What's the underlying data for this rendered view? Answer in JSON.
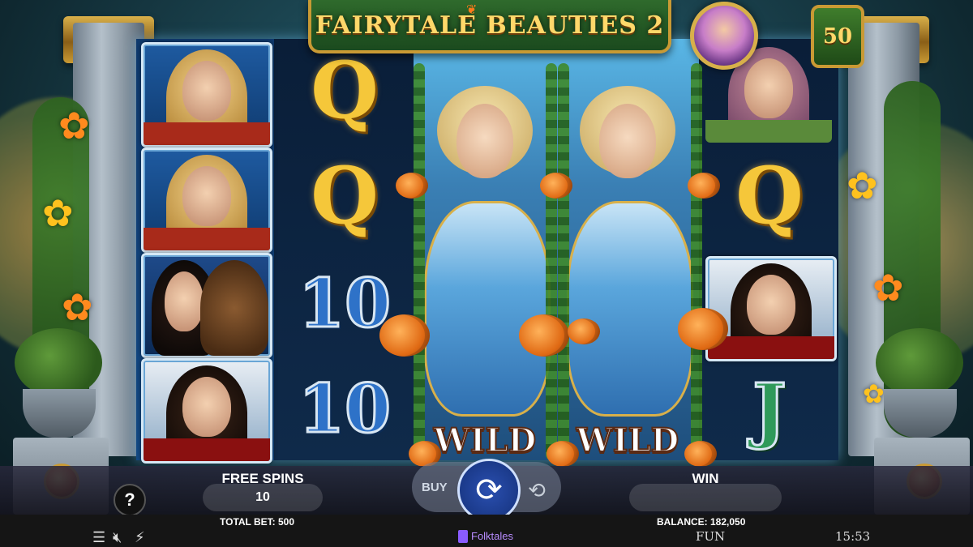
{
  "game": {
    "title": "FAIRYTALE BEAUTIES 2",
    "lines_badge": "50"
  },
  "reels": {
    "reel1": [
      "blonde-heroine-portrait",
      "blonde-heroine-portrait",
      "beauty-and-beast-portrait",
      "queen-portrait"
    ],
    "reel2": [
      "Q",
      "Q",
      "10",
      "10"
    ],
    "reel3": {
      "symbol": "wild-cinderella",
      "label": "WILD"
    },
    "reel4": {
      "symbol": "wild-cinderella",
      "label": "WILD"
    },
    "reel5": [
      "princess-portrait",
      "Q",
      "queen-portrait",
      "J"
    ]
  },
  "controls": {
    "free_spins_label": "FREE SPINS",
    "free_spins_value": "10",
    "total_bet": "TOTAL BET: 500",
    "buy_label": "BUY",
    "spin_icon": "spin-icon",
    "autoplay_icon": "autoplay-icon",
    "win_label": "WIN",
    "win_value": "",
    "balance": "BALANCE: 182,050",
    "info_label": "?"
  },
  "footer": {
    "brand": "Folktales",
    "mode": "FUN",
    "time": "15:53",
    "menu_icon": "menu-icon",
    "sound_icon": "sound-muted-icon",
    "turbo_icon": "turbo-icon"
  },
  "colors": {
    "title_gold": "#ffd86a",
    "frame_gold": "#c99a34",
    "spin_blue": "#1b3a8a",
    "brand_purple": "#8a5cff"
  }
}
